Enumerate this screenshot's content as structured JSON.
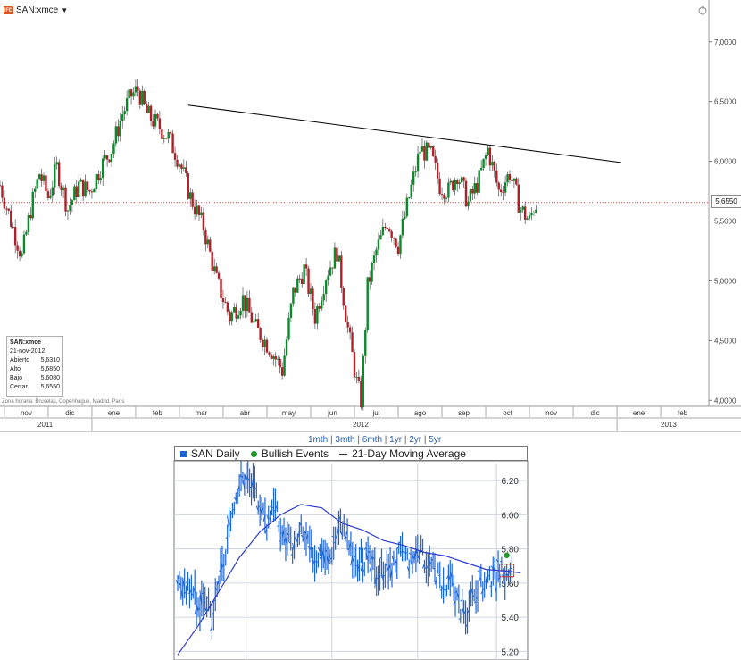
{
  "top": {
    "symbol": "SAN:xmce",
    "caret": "▼",
    "icon_text": "IFD",
    "last_price": "5,6550",
    "timezone": "Zona horaria: Bruselas, Copenhague, Madrid, París",
    "ohlc": {
      "symbol": "SAN:xmce",
      "date": "21-nov-2012",
      "rows": [
        {
          "label": "Abierto",
          "value": "5,6310"
        },
        {
          "label": "Alto",
          "value": "5,6850"
        },
        {
          "label": "Bajo",
          "value": "5,6080"
        },
        {
          "label": "Cerrar",
          "value": "5,6550"
        }
      ]
    },
    "years": [
      "2011",
      "2012",
      "2013"
    ]
  },
  "bottom": {
    "range_links": [
      "1mth",
      "3mth",
      "6mth",
      "1yr",
      "2yr",
      "5yr"
    ],
    "legend": {
      "series": "SAN Daily",
      "events": "Bullish Events",
      "ma": "21-Day Moving Average"
    }
  },
  "chart_data": [
    {
      "type": "line",
      "title": "",
      "symbol": "SAN:xmce",
      "y_axis": {
        "ticks": [
          "7,0000",
          "6,5000",
          "6,0000",
          "5,5000",
          "5,0000",
          "4,5000",
          "4,0000"
        ],
        "tick_values": [
          7.0,
          6.5,
          6.0,
          5.5,
          5.0,
          4.5,
          4.0
        ],
        "range": [
          3.95,
          7.2
        ]
      },
      "x_axis": {
        "months": [
          "nov",
          "dic",
          "ene",
          "feb",
          "mar",
          "abr",
          "may",
          "jun",
          "jul",
          "ago",
          "sep",
          "oct",
          "nov",
          "dic",
          "ene",
          "feb"
        ],
        "month_index": [
          -2,
          -1,
          0,
          1,
          2,
          3,
          4,
          5,
          6,
          7,
          8,
          9,
          10,
          11,
          12,
          13
        ],
        "range": [
          -2.1,
          14.1
        ]
      },
      "series": [
        {
          "x": [
            -2.1,
            -1.85,
            -1.6,
            -1.4,
            -1.2,
            -1.0,
            -0.8,
            -0.55,
            -0.3,
            -0.05,
            0.2,
            0.45,
            0.7,
            0.9,
            1.05,
            1.25,
            1.5,
            1.75,
            2.0,
            2.25,
            2.55,
            2.85,
            3.15,
            3.45,
            3.75,
            4.05,
            4.35,
            4.6,
            4.85,
            5.1,
            5.35,
            5.6,
            5.85,
            6.05,
            6.15,
            6.3,
            6.5,
            6.75,
            7.0,
            7.25,
            7.5,
            7.75,
            7.95,
            8.15,
            8.35,
            8.6,
            8.85,
            9.05,
            9.3,
            9.55,
            9.8,
            10.0,
            10.1,
            10.2
          ],
          "close": [
            5.8,
            5.5,
            5.2,
            5.6,
            5.9,
            5.7,
            5.95,
            5.6,
            5.8,
            5.75,
            5.95,
            6.1,
            6.4,
            6.55,
            6.6,
            6.4,
            6.3,
            6.2,
            6.0,
            5.7,
            5.45,
            5.0,
            4.7,
            4.85,
            4.6,
            4.45,
            4.25,
            4.9,
            5.1,
            4.7,
            5.05,
            5.25,
            4.6,
            4.15,
            4.0,
            4.95,
            5.25,
            5.5,
            5.3,
            5.7,
            6.1,
            6.05,
            5.8,
            5.75,
            5.9,
            5.65,
            5.85,
            6.1,
            5.75,
            5.9,
            5.6,
            5.5,
            5.62,
            5.66
          ]
        },
        {
          "name": "",
          "kind": "trendline",
          "x": [
            2.2,
            12.1
          ],
          "y": [
            6.47,
            5.99
          ]
        },
        {
          "kind": "last-price-line",
          "y": 5.655
        }
      ]
    },
    {
      "type": "line",
      "title": "",
      "y_axis": {
        "ticks": [
          "6.20",
          "6.00",
          "5.80",
          "5.60",
          "5.40",
          "5.20"
        ],
        "tick_values": [
          6.2,
          6.0,
          5.8,
          5.6,
          5.4,
          5.2
        ],
        "range": [
          5.15,
          6.3
        ]
      },
      "x_axis": {
        "range": [
          0,
          100
        ]
      },
      "series": [
        {
          "name": "SAN Daily",
          "kind": "bars",
          "x": [
            0,
            2,
            4,
            6,
            8,
            10,
            12,
            14,
            16,
            18,
            20,
            22,
            24,
            26,
            28,
            30,
            32,
            34,
            36,
            38,
            40,
            42,
            44,
            46,
            48,
            50,
            52,
            54,
            56,
            58,
            60,
            62,
            64,
            66,
            68,
            70,
            72,
            74,
            76,
            78,
            80,
            82,
            84,
            86,
            88,
            90,
            92,
            94,
            96,
            98
          ],
          "y": [
            5.62,
            5.55,
            5.6,
            5.45,
            5.55,
            5.35,
            5.62,
            5.75,
            6.05,
            6.2,
            6.22,
            6.15,
            6.08,
            5.95,
            6.1,
            5.9,
            5.85,
            5.8,
            5.9,
            5.82,
            5.75,
            5.8,
            5.72,
            5.88,
            5.95,
            5.82,
            5.7,
            5.75,
            5.72,
            5.65,
            5.7,
            5.68,
            5.75,
            5.78,
            5.72,
            5.8,
            5.75,
            5.7,
            5.65,
            5.55,
            5.62,
            5.48,
            5.4,
            5.5,
            5.6,
            5.58,
            5.62,
            5.66,
            5.64,
            5.65
          ]
        },
        {
          "name": "21-Day Moving Average",
          "x": [
            0,
            6,
            12,
            18,
            24,
            30,
            36,
            42,
            48,
            54,
            60,
            66,
            72,
            78,
            84,
            90,
            96,
            100
          ],
          "y": [
            5.18,
            5.35,
            5.55,
            5.75,
            5.9,
            6.0,
            6.06,
            6.04,
            5.95,
            5.91,
            5.85,
            5.82,
            5.78,
            5.76,
            5.72,
            5.68,
            5.67,
            5.66
          ]
        },
        {
          "name": "Bullish Events",
          "kind": "marker",
          "x": [
            96
          ],
          "y": [
            5.7
          ]
        }
      ]
    }
  ],
  "colors": {
    "up": "#0a8a2a",
    "down": "#b0202a",
    "trendline": "#000000",
    "last_price": "#d84040",
    "bottom_bars": "#1e66d6",
    "moving_average": "#2a3ad0",
    "bullish": "#1e9a2a",
    "marker_box": "#c03030"
  }
}
